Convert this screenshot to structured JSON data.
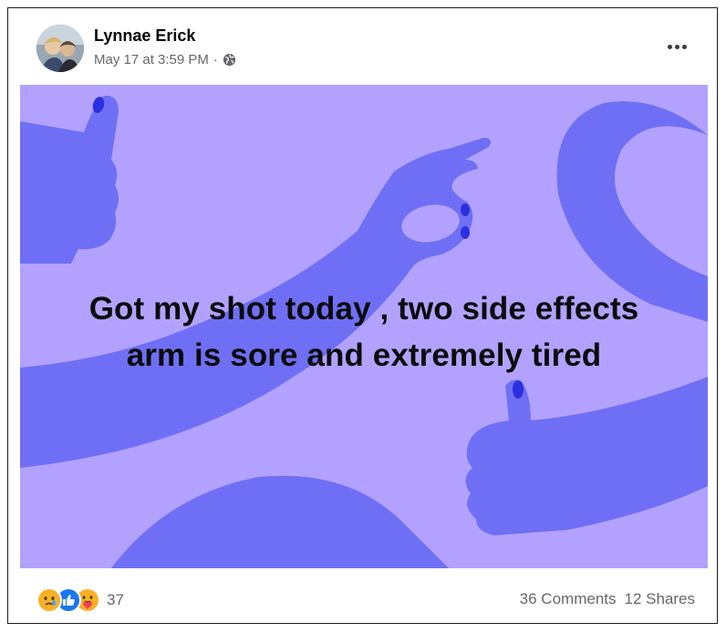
{
  "post": {
    "author": "Lynnae Erick",
    "timestamp": "May 17 at 3:59 PM",
    "separator": "·",
    "privacy_icon": "globe-icon",
    "text_line1": "Got my shot today , two side effects",
    "text_line2": "arm is sore and extremely tired",
    "background_color": "#b3a1ff",
    "shape_color": "#6f6ff5",
    "nail_color": "#2b2fe0"
  },
  "footer": {
    "reaction_icons": [
      "care-icon",
      "like-icon",
      "love-care-icon"
    ],
    "reaction_count": "37",
    "comments": "36 Comments",
    "shares": "12 Shares"
  }
}
